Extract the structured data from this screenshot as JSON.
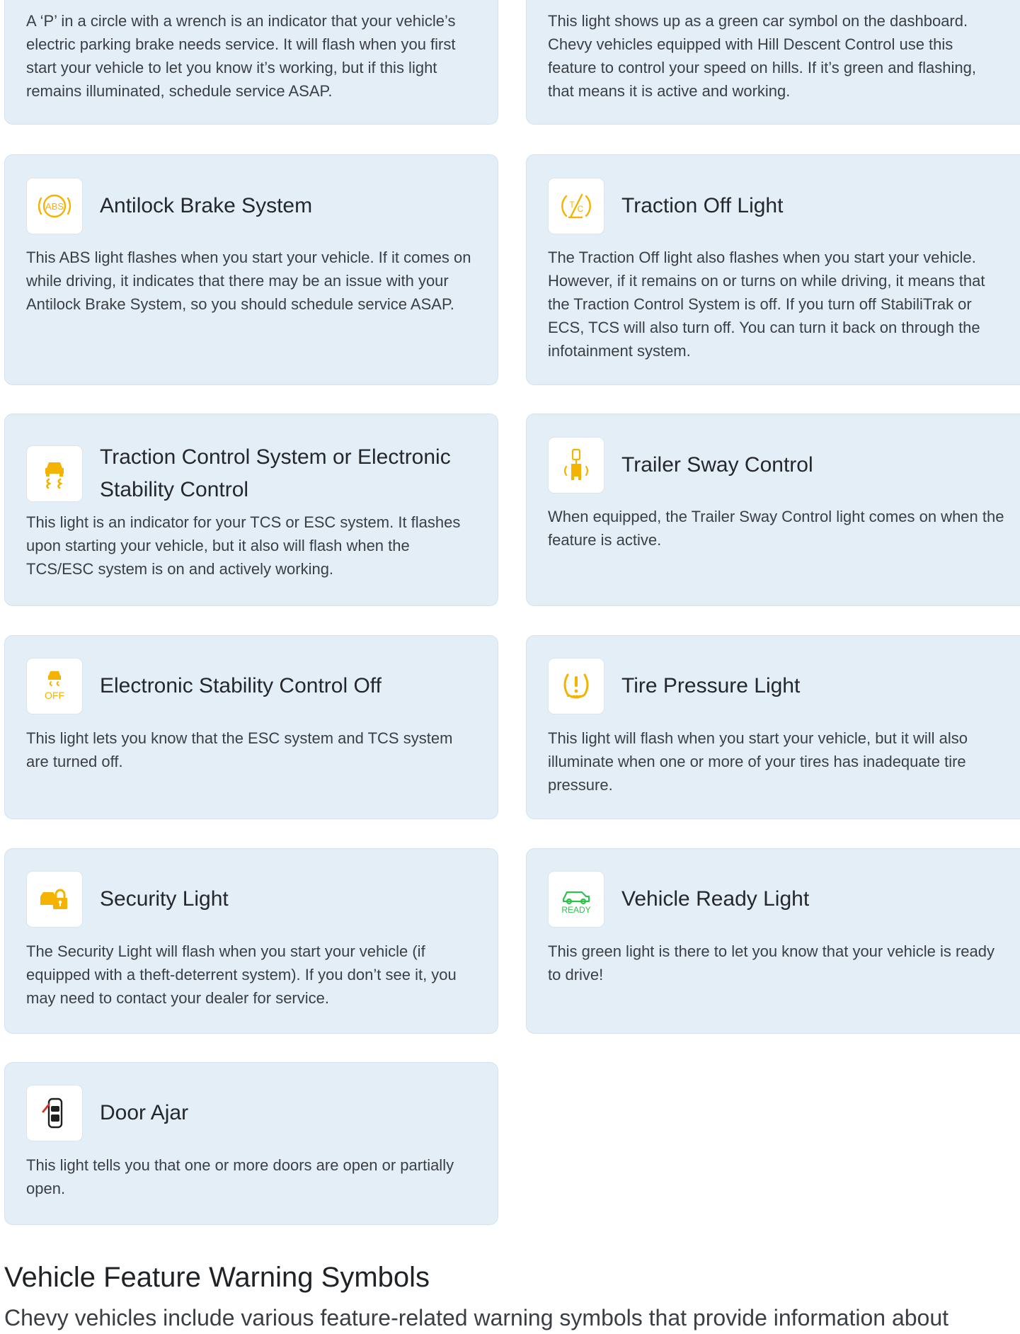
{
  "colors": {
    "card_bg": "#e4eef7",
    "amber": "#f5b301",
    "green": "#2bc44b",
    "red": "#d9342b"
  },
  "cards": [
    {
      "title": "",
      "icon": "",
      "desc": "A ‘P’ in a circle with a wrench is an indicator that your vehicle’s electric parking brake needs service. It will flash when you first start your vehicle to let you know it’s working, but if this light remains illuminated, schedule service ASAP."
    },
    {
      "title": "",
      "icon": "",
      "desc": "This light shows up as a green car symbol on the dashboard. Chevy vehicles equipped with Hill Descent Control use this feature to control your speed on hills. If it’s green and flashing, that means it is active and working."
    },
    {
      "title": "Antilock Brake System",
      "icon": "abs-icon",
      "desc": "This ABS light flashes when you start your vehicle. If it comes on while driving, it indicates that there may be an issue with your Antilock Brake System, so you should schedule service ASAP."
    },
    {
      "title": "Traction Off Light",
      "icon": "traction-off-icon",
      "desc": "The Traction Off light also flashes when you start your vehicle. However, if it remains on or turns on while driving, it means that the Traction Control System is off. If you turn off StabiliTrak or ECS, TCS will also turn off. You can turn it back on through the infotainment system."
    },
    {
      "title": "Traction Control System or Electronic Stability Control",
      "icon": "traction-control-icon",
      "desc": "This light is an indicator for your TCS or ESC system. It flashes upon starting your vehicle, but it also will flash when the TCS/ESC system is on and actively working."
    },
    {
      "title": "Trailer Sway Control",
      "icon": "trailer-sway-icon",
      "desc": "When equipped, the Trailer Sway Control light comes on when the feature is active."
    },
    {
      "title": "Electronic Stability Control Off",
      "icon": "esc-off-icon",
      "icon_text": "OFF",
      "desc": "This light lets you know that the ESC system and TCS system are turned off."
    },
    {
      "title": "Tire Pressure Light",
      "icon": "tire-pressure-icon",
      "desc": "This light will flash when you start your vehicle, but it will also illuminate when one or more of your tires has inadequate tire pressure."
    },
    {
      "title": "Security Light",
      "icon": "security-icon",
      "desc": "The Security Light will flash when you start your vehicle (if equipped with a theft-deterrent system). If you don’t see it, you may need to contact your dealer for service."
    },
    {
      "title": "Vehicle Ready Light",
      "icon": "vehicle-ready-icon",
      "icon_text": "READY",
      "desc": "This green light is there to let you know that your vehicle is ready to drive!"
    },
    {
      "title": "Door Ajar",
      "icon": "door-ajar-icon",
      "desc": "This light tells you that one or more doors are open or partially open."
    }
  ],
  "section": {
    "title": "Vehicle Feature Warning Symbols",
    "intro": "Chevy vehicles include various feature-related warning symbols that provide information about"
  }
}
